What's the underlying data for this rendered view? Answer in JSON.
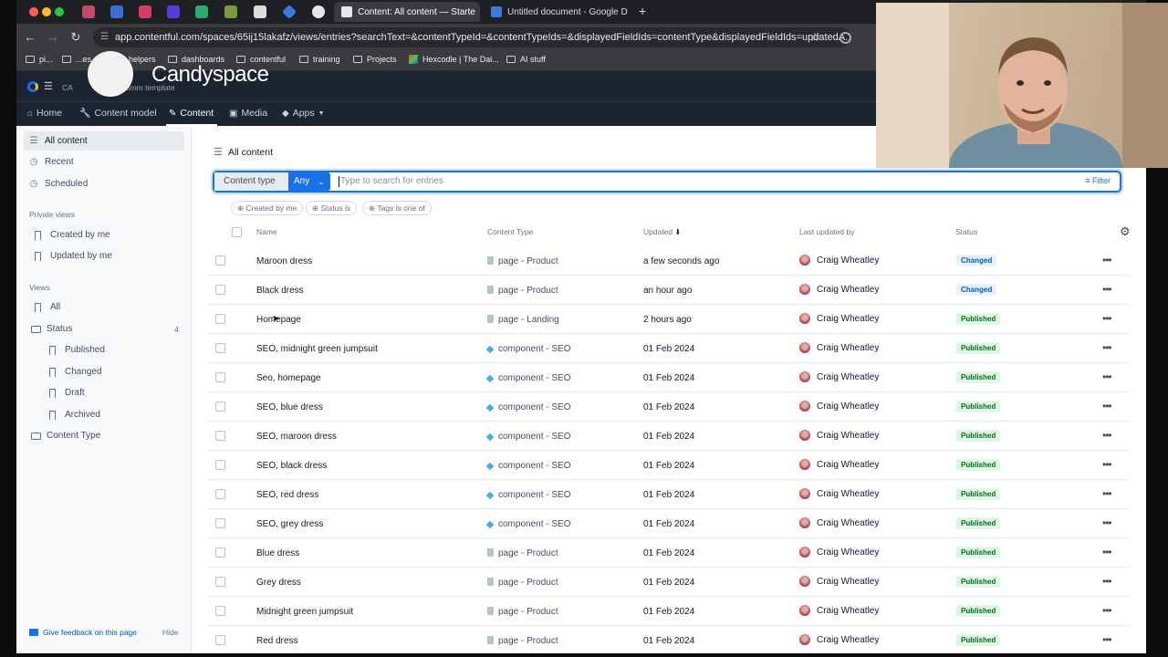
{
  "browser": {
    "tabs": [
      {
        "title": "Content: All content — Starte",
        "active": true
      },
      {
        "title": "Untitled document - Google D",
        "active": false
      }
    ],
    "new_tab": "+",
    "url": "app.contentful.com/spaces/65ij15lakafz/views/entries?searchText=&contentTypeId=&contentTypeIds=&displayedFieldIds=contentType&displayedFieldIds=updatedA...",
    "bookmarks": [
      "pi...",
      "...es",
      "helpers",
      "dashboards",
      "contentful",
      "training",
      "Projects",
      "Hexcodle | The Dai...",
      "AI stuff"
    ]
  },
  "overlay": {
    "brand": "Candyspace"
  },
  "app": {
    "space_label": "CA",
    "space_name": "...er eComm template",
    "nav": [
      {
        "label": "Home",
        "icon": "home-icon"
      },
      {
        "label": "Content model",
        "icon": "wrench-icon"
      },
      {
        "label": "Content",
        "icon": "feather-icon"
      },
      {
        "label": "Media",
        "icon": "image-icon"
      },
      {
        "label": "Apps",
        "icon": "apps-icon"
      }
    ]
  },
  "sidebar": {
    "top": [
      "All content",
      "Recent",
      "Scheduled"
    ],
    "private_heading": "Private views",
    "private": [
      "Created by me",
      "Updated by me"
    ],
    "views_heading": "Views",
    "views_all": "All",
    "status_folder": "Status",
    "status_count": "4",
    "status_items": [
      "Published",
      "Changed",
      "Draft",
      "Archived"
    ],
    "content_type_folder": "Content Type",
    "feedback": "Give feedback on this page",
    "hide": "Hide"
  },
  "main": {
    "title": "All content",
    "search": {
      "content_type_label": "Content type",
      "any_label": "Any",
      "placeholder": "Type to search for entries",
      "filter_label": "Filter"
    },
    "pills": [
      "Created by me",
      "Status is",
      "Tags is one of"
    ],
    "columns": {
      "name": "Name",
      "content_type": "Content Type",
      "updated": "Updated",
      "last_updated_by": "Last updated by",
      "status": "Status"
    },
    "rows": [
      {
        "name": "Maroon dress",
        "type": "page - Product",
        "kind": "page",
        "updated": "a few seconds ago",
        "by": "Craig Wheatley",
        "status": "Changed"
      },
      {
        "name": "Black dress",
        "type": "page - Product",
        "kind": "page",
        "updated": "an hour ago",
        "by": "Craig Wheatley",
        "status": "Changed"
      },
      {
        "name": "Homepage",
        "type": "page - Landing",
        "kind": "page",
        "updated": "2 hours ago",
        "by": "Craig Wheatley",
        "status": "Published"
      },
      {
        "name": "SEO, midnight green jumpsuit",
        "type": "component - SEO",
        "kind": "component",
        "updated": "01 Feb 2024",
        "by": "Craig Wheatley",
        "status": "Published"
      },
      {
        "name": "Seo, homepage",
        "type": "component - SEO",
        "kind": "component",
        "updated": "01 Feb 2024",
        "by": "Craig Wheatley",
        "status": "Published"
      },
      {
        "name": "SEO, blue dress",
        "type": "component - SEO",
        "kind": "component",
        "updated": "01 Feb 2024",
        "by": "Craig Wheatley",
        "status": "Published"
      },
      {
        "name": "SEO, maroon dress",
        "type": "component - SEO",
        "kind": "component",
        "updated": "01 Feb 2024",
        "by": "Craig Wheatley",
        "status": "Published"
      },
      {
        "name": "SEO, black dress",
        "type": "component - SEO",
        "kind": "component",
        "updated": "01 Feb 2024",
        "by": "Craig Wheatley",
        "status": "Published"
      },
      {
        "name": "SEO, red dress",
        "type": "component - SEO",
        "kind": "component",
        "updated": "01 Feb 2024",
        "by": "Craig Wheatley",
        "status": "Published"
      },
      {
        "name": "SEO, grey dress",
        "type": "component - SEO",
        "kind": "component",
        "updated": "01 Feb 2024",
        "by": "Craig Wheatley",
        "status": "Published"
      },
      {
        "name": "Blue dress",
        "type": "page - Product",
        "kind": "page",
        "updated": "01 Feb 2024",
        "by": "Craig Wheatley",
        "status": "Published"
      },
      {
        "name": "Grey dress",
        "type": "page - Product",
        "kind": "page",
        "updated": "01 Feb 2024",
        "by": "Craig Wheatley",
        "status": "Published"
      },
      {
        "name": "Midnight green jumpsuit",
        "type": "page - Product",
        "kind": "page",
        "updated": "01 Feb 2024",
        "by": "Craig Wheatley",
        "status": "Published"
      },
      {
        "name": "Red dress",
        "type": "page - Product",
        "kind": "page",
        "updated": "01 Feb 2024",
        "by": "Craig Wheatley",
        "status": "Published"
      }
    ]
  }
}
